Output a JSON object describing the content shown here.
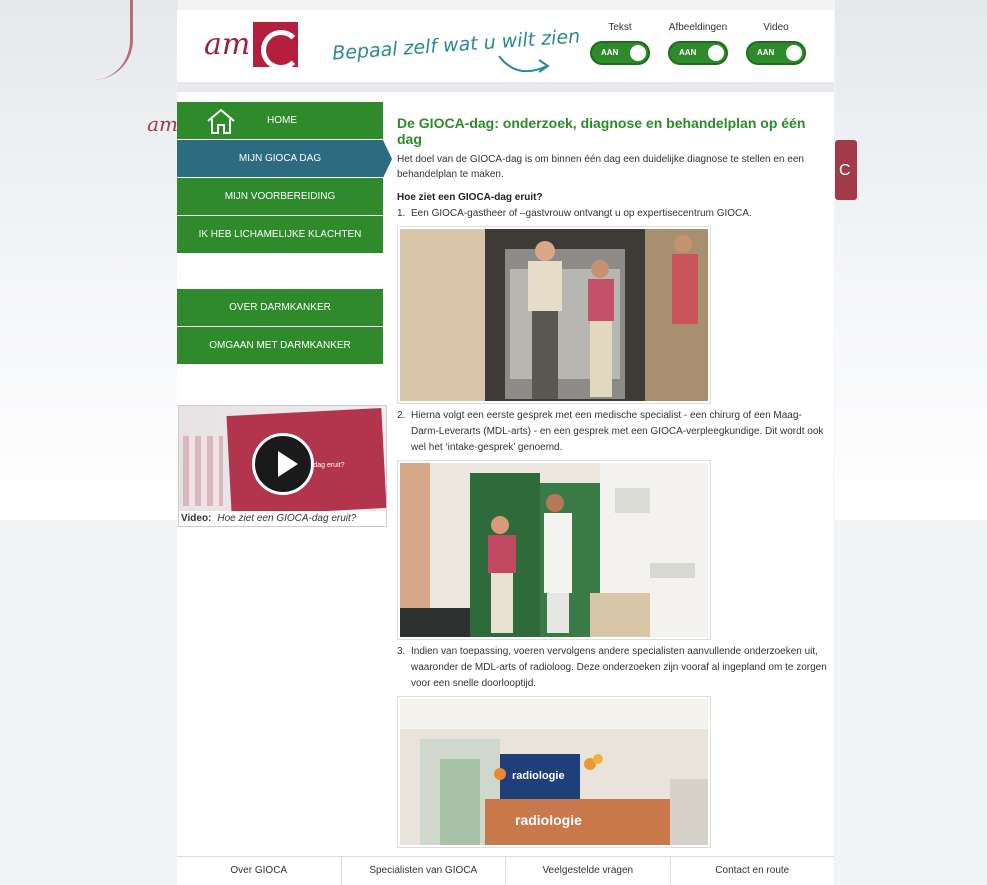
{
  "brand": {
    "logo_text": "am",
    "tagline": "Bepaal zelf wat u wilt zien"
  },
  "toggles": [
    {
      "label": "Tekst",
      "state": "AAN"
    },
    {
      "label": "Afbeeldingen",
      "state": "AAN"
    },
    {
      "label": "Video",
      "state": "AAN"
    }
  ],
  "nav": {
    "home": "HOME",
    "items": [
      "MIJN GIOCA DAG",
      "MIJN VOORBEREIDING",
      "IK HEB LICHAMELIJKE KLACHTEN"
    ],
    "items2": [
      "OVER DARMKANKER",
      "OMGAAN MET DARMKANKER"
    ]
  },
  "video": {
    "label": "Video:",
    "title": "Hoe ziet een GIOCA-dag eruit?",
    "thumb_text": "-dag eruit?"
  },
  "content": {
    "title": "De GIOCA-dag: onderzoek, diagnose en behandelplan op één dag",
    "intro": "Het doel van de GIOCA-dag is om binnen één dag een duidelijke diagnose te stellen en een behandelplan te maken.",
    "subhead": "Hoe ziet een GIOCA-dag eruit?",
    "steps": [
      {
        "num": "1.",
        "text": "Een GIOCA-gastheer of –gastvrouw ontvangt u op expertisecentrum GIOCA."
      },
      {
        "num": "2.",
        "text": "Hierna volgt een eerste gesprek met een medische specialist - een chirurg of een Maag-Darm-Leverarts (MDL-arts) - en een gesprek met een GIOCA-verpleegkundige. Dit wordt ook wel het ‘intake-gesprek’ genoemd."
      },
      {
        "num": "3.",
        "text": "Indien van toepassing, voeren vervolgens andere specialisten aanvullende onderzoeken uit, waaronder de MDL-arts of radioloog. Deze onderzoeken zijn vooraf al ingepland om te zorgen voor een snelle doorlooptijd."
      }
    ],
    "radiology_sign": "radiologie"
  },
  "footer": [
    "Over GIOCA",
    "Specialisten van GIOCA",
    "Veelgestelde vragen",
    "Contact en route"
  ],
  "colors": {
    "green": "#2e8a2b",
    "teal": "#2d6b80",
    "brand_red": "#b31f3c"
  }
}
